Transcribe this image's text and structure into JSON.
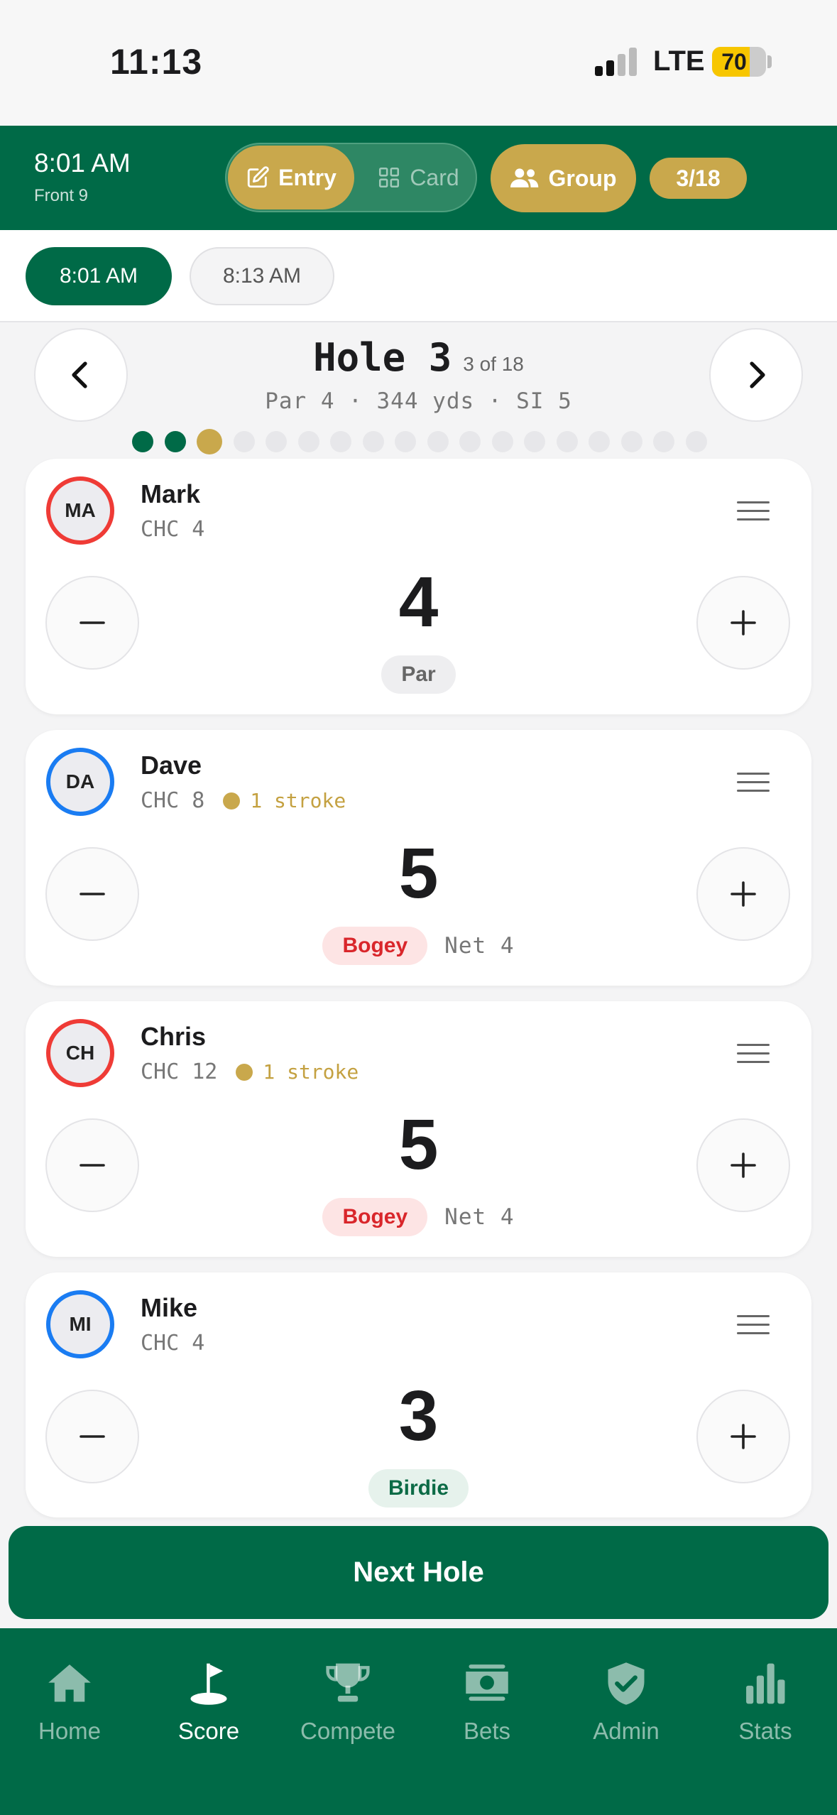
{
  "status_bar": {
    "time": "11:13",
    "network": "LTE",
    "battery": "70",
    "battery_level": 0.7
  },
  "header": {
    "tee_time": "8:01 AM",
    "tee_sub": "Front 9",
    "entry_label": "Entry",
    "card_label": "Card",
    "group_label": "Group",
    "progress": "3/18"
  },
  "time_tabs": [
    "8:01 AM",
    "8:13 AM"
  ],
  "hole": {
    "title": "Hole 3",
    "of": "3 of 18",
    "info": "Par 4 · 344 yds · SI 5",
    "total_holes": 18,
    "current": 3
  },
  "players": [
    {
      "initials": "MA",
      "name": "Mark",
      "chc": "CHC 4",
      "stroke": "",
      "score": "4",
      "result": "Par",
      "result_type": "par",
      "net": "",
      "ring": "red"
    },
    {
      "initials": "DA",
      "name": "Dave",
      "chc": "CHC 8",
      "stroke": "1 stroke",
      "score": "5",
      "result": "Bogey",
      "result_type": "bogey",
      "net": "Net 4",
      "ring": "blue"
    },
    {
      "initials": "CH",
      "name": "Chris",
      "chc": "CHC 12",
      "stroke": "1 stroke",
      "score": "5",
      "result": "Bogey",
      "result_type": "bogey",
      "net": "Net 4",
      "ring": "red"
    },
    {
      "initials": "MI",
      "name": "Mike",
      "chc": "CHC 4",
      "stroke": "",
      "score": "3",
      "result": "Birdie",
      "result_type": "birdie",
      "net": "",
      "ring": "blue"
    }
  ],
  "next_hole_label": "Next Hole",
  "tabs": [
    {
      "label": "Home",
      "icon": "home-icon",
      "active": false
    },
    {
      "label": "Score",
      "icon": "flag-icon",
      "active": true
    },
    {
      "label": "Compete",
      "icon": "trophy-icon",
      "active": false
    },
    {
      "label": "Bets",
      "icon": "money-icon",
      "active": false
    },
    {
      "label": "Admin",
      "icon": "shield-check-icon",
      "active": false
    },
    {
      "label": "Stats",
      "icon": "bar-chart-icon",
      "active": false
    }
  ],
  "colors": {
    "primary": "#006a47",
    "gold": "#c9a84c",
    "red": "#ef3b36",
    "blue": "#1a7cf2"
  }
}
